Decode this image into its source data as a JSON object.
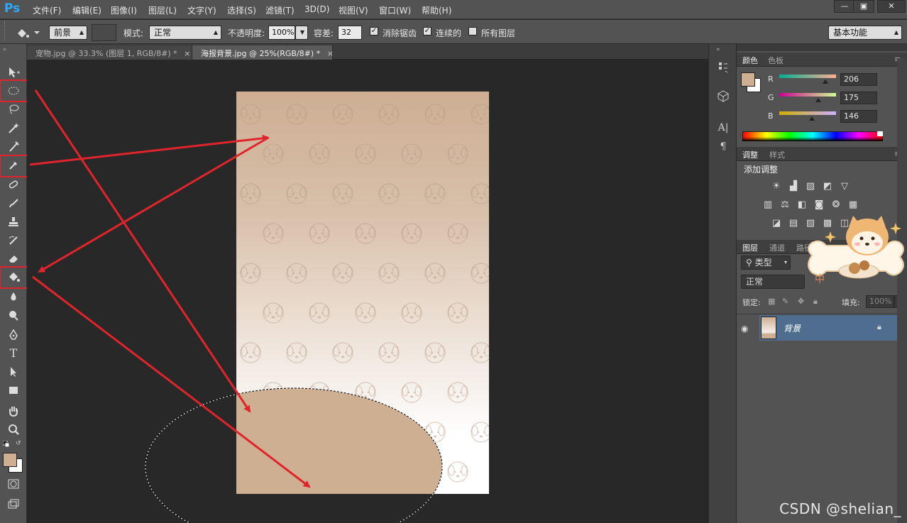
{
  "app": {
    "logo": "Ps"
  },
  "menu": [
    "文件(F)",
    "编辑(E)",
    "图像(I)",
    "图层(L)",
    "文字(Y)",
    "选择(S)",
    "滤镜(T)",
    "3D(D)",
    "视图(V)",
    "窗口(W)",
    "帮助(H)"
  ],
  "window_controls": {
    "minimize": "—",
    "restore": "▣",
    "close": "✕"
  },
  "options": {
    "fill_source": "前景",
    "mode_label": "模式:",
    "mode_value": "正常",
    "opacity_label": "不透明度:",
    "opacity_value": "100%",
    "tolerance_label": "容差:",
    "tolerance_value": "32",
    "antialias_label": "消除锯齿",
    "antialias_checked": true,
    "contiguous_label": "连续的",
    "contiguous_checked": true,
    "all_layers_label": "所有图层",
    "all_layers_checked": false,
    "workspace": "基本功能"
  },
  "tabs": [
    {
      "label": "宠物.jpg @ 33.3% (图层 1, RGB/8#) *",
      "active": false
    },
    {
      "label": "海报背景.jpg @ 25%(RGB/8#) *",
      "active": true
    }
  ],
  "tab_close": "×",
  "tools": [
    "move-tool-icon",
    "elliptical-marquee-icon",
    "lasso-icon",
    "magic-wand-icon",
    "crop-icon",
    "eyedropper-icon",
    "healing-brush-icon",
    "brush-icon",
    "clone-stamp-icon",
    "history-brush-icon",
    "eraser-icon",
    "paint-bucket-icon",
    "blur-icon",
    "dodge-icon",
    "pen-icon",
    "type-tool-icon",
    "path-selection-icon",
    "rectangle-icon",
    "hand-icon",
    "zoom-icon"
  ],
  "type_tool_glyph": "T",
  "colors": {
    "foreground": "#ceaf92",
    "background": "#ffffff",
    "highlight": "#e0242b",
    "layer_selected": "#4f6d8e"
  },
  "color_panel": {
    "tab_active": "颜色",
    "tab_other": "色板",
    "r_label": "R",
    "g_label": "G",
    "b_label": "B",
    "r_value": "206",
    "g_value": "175",
    "b_value": "146",
    "r": 206,
    "g": 175,
    "b": 146
  },
  "adjust_panel": {
    "tab_active": "调整",
    "tab_other": "样式",
    "add_label": "添加调整"
  },
  "layers_panel": {
    "tab_active": "图层",
    "tab_channels": "通道",
    "tab_paths": "路径",
    "filter_label": "类型",
    "blend_mode": "正常",
    "lock_label": "锁定:",
    "fill_label": "填充:",
    "fill_value": "100%",
    "layer_name": "背景"
  },
  "sticker_text": "中",
  "watermark": "CSDN @shelian_"
}
